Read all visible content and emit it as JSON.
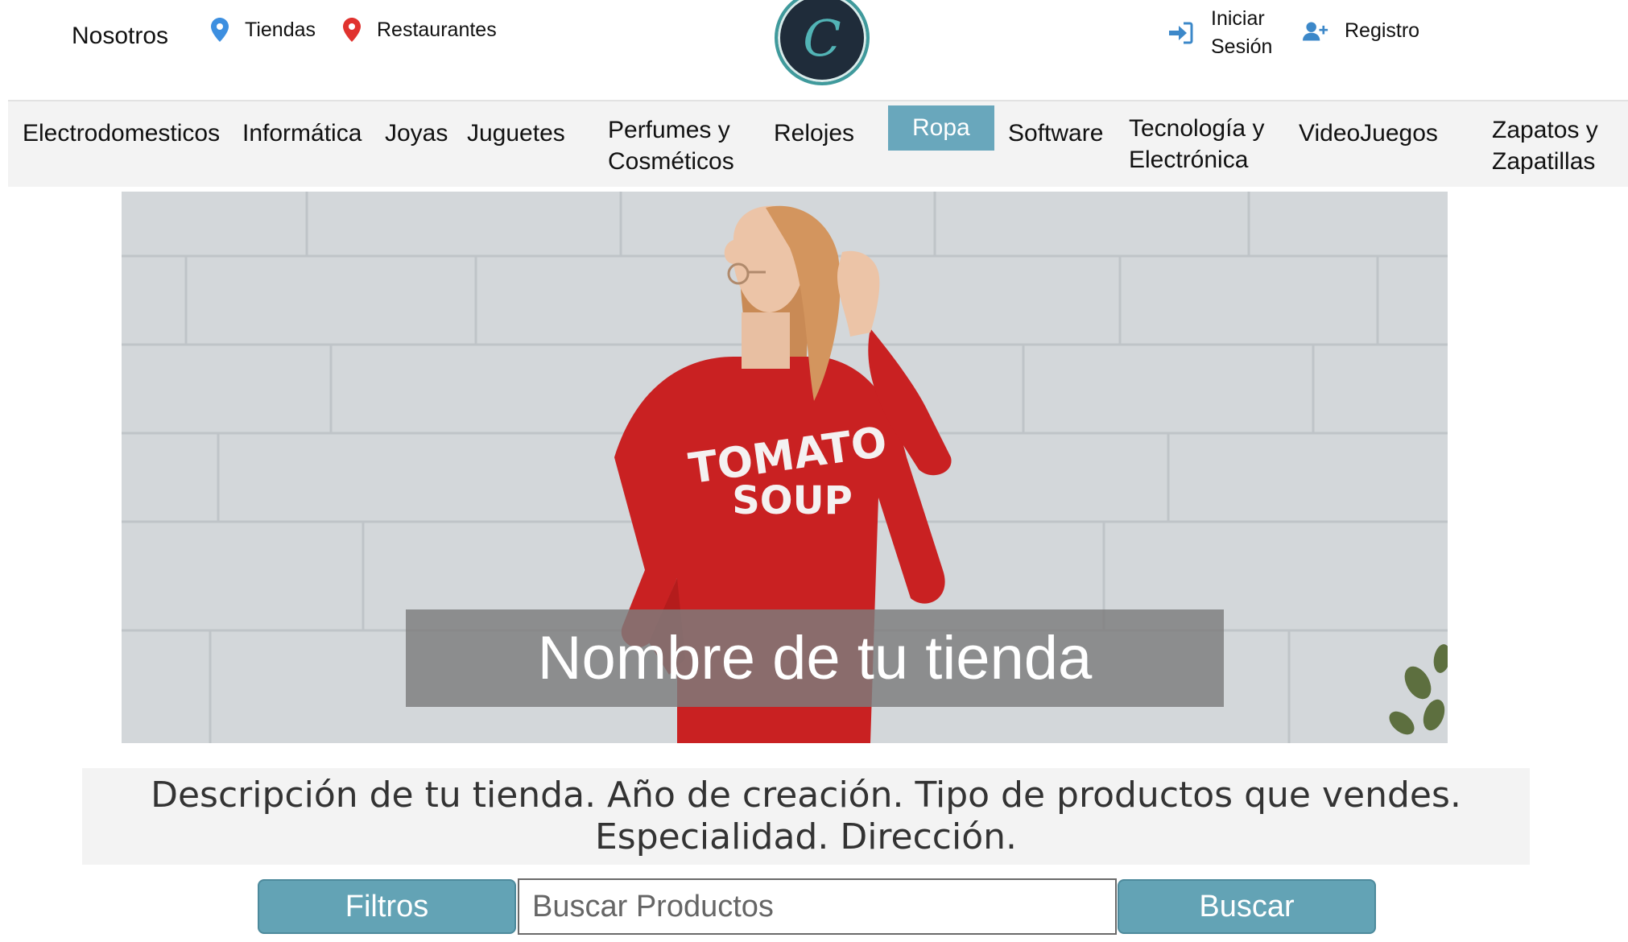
{
  "header": {
    "nosotros": "Nosotros",
    "tiendas": "Tiendas",
    "restaurantes": "Restaurantes",
    "logo_letter": "C",
    "login_line1": "Iniciar",
    "login_line2": "Sesión",
    "registro": "Registro"
  },
  "categories": [
    {
      "l1": "Electrodomesticos",
      "l2": ""
    },
    {
      "l1": "Informática",
      "l2": ""
    },
    {
      "l1": "Joyas",
      "l2": ""
    },
    {
      "l1": "Juguetes",
      "l2": ""
    },
    {
      "l1": "Perfumes y",
      "l2": "Cosméticos"
    },
    {
      "l1": "Relojes",
      "l2": ""
    },
    {
      "l1": "Ropa",
      "l2": "",
      "active": true
    },
    {
      "l1": "Software",
      "l2": ""
    },
    {
      "l1": "Tecnología y",
      "l2": "Electrónica"
    },
    {
      "l1": "VideoJuegos",
      "l2": ""
    },
    {
      "l1": "Zapatos y",
      "l2": "Zapatillas"
    }
  ],
  "hero": {
    "title": "Nombre de tu tienda",
    "shirt_line1": "TOMATO",
    "shirt_line2": "SOUP"
  },
  "description": {
    "line1": "Descripción de tu tienda. Año de creación. Tipo de productos que vendes.",
    "line2": "Especialidad. Dirección."
  },
  "search": {
    "filters_label": "Filtros",
    "placeholder": "Buscar Productos",
    "value": "",
    "submit_label": "Buscar"
  },
  "colors": {
    "accent": "#69a7bc",
    "button": "#63a3b5",
    "pin_blue": "#3d8fe0",
    "pin_red": "#e0322e",
    "icon_blue": "#3c88c9"
  }
}
